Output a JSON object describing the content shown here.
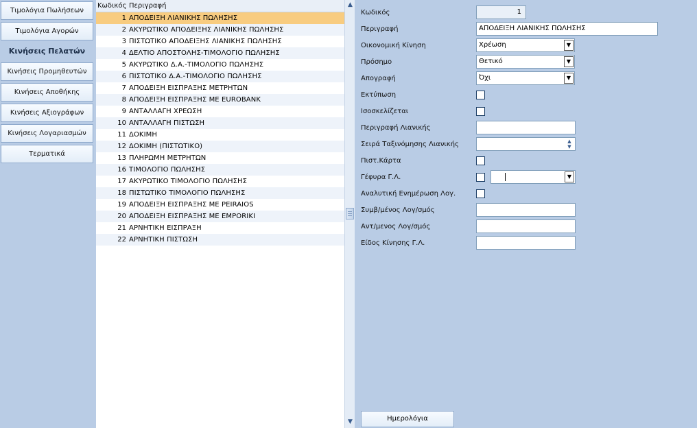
{
  "nav": {
    "items": [
      {
        "label": "Τιμολόγια Πωλήσεων",
        "active": false
      },
      {
        "label": "Τιμολόγια Αγορών",
        "active": false
      },
      {
        "label": "Κινήσεις Πελατών",
        "active": true
      },
      {
        "label": "Κινήσεις Προμηθευτών",
        "active": false
      },
      {
        "label": "Κινήσεις Αποθήκης",
        "active": false
      },
      {
        "label": "Κινήσεις Αξιογράφων",
        "active": false
      },
      {
        "label": "Κινήσεις Λογαριασμών",
        "active": false
      },
      {
        "label": "Τερματικά",
        "active": false
      }
    ]
  },
  "grid": {
    "columns": {
      "code": "Κωδικός",
      "description": "Περιγραφή"
    },
    "selected_code": "1",
    "rows": [
      {
        "code": "1",
        "description": "ΑΠΟΔΕΙΞΗ ΛΙΑΝΙΚΗΣ ΠΩΛΗΣΗΣ"
      },
      {
        "code": "2",
        "description": "ΑΚΥΡΩΤΙΚΟ ΑΠΟΔΕΙΞΗΣ ΛΙΑΝΙΚΗΣ ΠΩΛΗΣΗΣ"
      },
      {
        "code": "3",
        "description": "ΠΙΣΤΩΤΙΚΟ ΑΠΟΔΕΙΞΗΣ ΛΙΑΝΙΚΗΣ ΠΩΛΗΣΗΣ"
      },
      {
        "code": "4",
        "description": "ΔΕΛΤΙΟ ΑΠΟΣΤΟΛΗΣ-ΤΙΜΟΛΟΓΙΟ ΠΩΛΗΣΗΣ"
      },
      {
        "code": "5",
        "description": "ΑΚΥΡΩΤΙΚΟ Δ.Α.-ΤΙΜΟΛΟΓΙΟ ΠΩΛΗΣΗΣ"
      },
      {
        "code": "6",
        "description": "ΠΙΣΤΩΤΙΚΟ Δ.Α.-ΤΙΜΟΛΟΓΙΟ ΠΩΛΗΣΗΣ"
      },
      {
        "code": "7",
        "description": "ΑΠΟΔΕΙΞΗ ΕΙΣΠΡΑΞΗΣ ΜΕΤΡΗΤΩΝ"
      },
      {
        "code": "8",
        "description": "ΑΠΟΔΕΙΞΗ ΕΙΣΠΡΑΞΗΣ ΜΕ EUROBANK"
      },
      {
        "code": "9",
        "description": "ΑΝΤΑΛΛΑΓΗ ΧΡΕΩΣΗ"
      },
      {
        "code": "10",
        "description": "ΑΝΤΑΛΛΑΓΗ ΠΙΣΤΩΣΗ"
      },
      {
        "code": "11",
        "description": "ΔΟΚΙΜΗ"
      },
      {
        "code": "12",
        "description": "ΔΟΚΙΜΗ (ΠΙΣΤΩΤΙΚΟ)"
      },
      {
        "code": "13",
        "description": "ΠΛΗΡΩΜΗ ΜΕΤΡΗΤΩΝ"
      },
      {
        "code": "16",
        "description": "ΤΙΜΟΛΟΓΙΟ ΠΩΛΗΣΗΣ"
      },
      {
        "code": "17",
        "description": "ΑΚΥΡΩΤΙΚΟ ΤΙΜΟΛΟΓΙΟ ΠΩΛΗΣΗΣ"
      },
      {
        "code": "18",
        "description": "ΠΙΣΤΩΤΙΚΟ ΤΙΜΟΛΟΓΙΟ ΠΩΛΗΣΗΣ"
      },
      {
        "code": "19",
        "description": "ΑΠΟΔΕΙΞΗ ΕΙΣΠΡΑΞΗΣ ΜΕ PEIRAIOS"
      },
      {
        "code": "20",
        "description": "ΑΠΟΔΕΙΞΗ ΕΙΣΠΡΑΞΗΣ ΜΕ EMPORIKI"
      },
      {
        "code": "21",
        "description": "ΑΡΝΗΤΙΚΗ ΕΙΣΠΡΑΞΗ"
      },
      {
        "code": "22",
        "description": "ΑΡΝΗΤΙΚΗ ΠΙΣΤΩΣΗ"
      }
    ]
  },
  "form": {
    "code": {
      "label": "Κωδικός",
      "value": "1"
    },
    "description": {
      "label": "Περιγραφή",
      "value": "ΑΠΟΔΕΙΞΗ ΛΙΑΝΙΚΗΣ ΠΩΛΗΣΗΣ"
    },
    "financial_movement": {
      "label": "Οικονομική Κίνηση",
      "value": "Χρέωση"
    },
    "sign": {
      "label": "Πρόσημο",
      "value": "Θετικό"
    },
    "inventory": {
      "label": "Απογραφή",
      "value": "Όχι"
    },
    "print": {
      "label": "Εκτύπωση",
      "checked": false
    },
    "balances": {
      "label": "Ισοσκελίζεται",
      "checked": false
    },
    "retail_description": {
      "label": "Περιγραφή Λιανικής",
      "value": ""
    },
    "retail_sort_order": {
      "label": "Σειρά Ταξινόμησης Λιανικής",
      "value": ""
    },
    "credit_card": {
      "label": "Πιστ.Κάρτα",
      "checked": false
    },
    "gl_bridge": {
      "label": "Γέφυρα Γ.Λ.",
      "checked": false,
      "value": ""
    },
    "analytic_update": {
      "label": "Αναλυτική Ενημέρωση Λογ.",
      "checked": false
    },
    "contract_account": {
      "label": "Συμβ/μένος Λογ/σμός",
      "value": ""
    },
    "counter_account": {
      "label": "Αντ/μενος Λογ/σμός",
      "value": ""
    },
    "gl_movement_type": {
      "label": "Είδος Κίνησης Γ.Λ.",
      "value": ""
    }
  },
  "calendar_button": {
    "label": "Ημερολόγια"
  },
  "icons": {
    "dropdown": "chevron-down-icon",
    "scroll_up": "arrow-up-icon",
    "scroll_down": "arrow-down-icon"
  },
  "colors": {
    "background": "#b9cce5",
    "selected_row": "#f8cc80",
    "alt_row": "#eef3fa"
  }
}
